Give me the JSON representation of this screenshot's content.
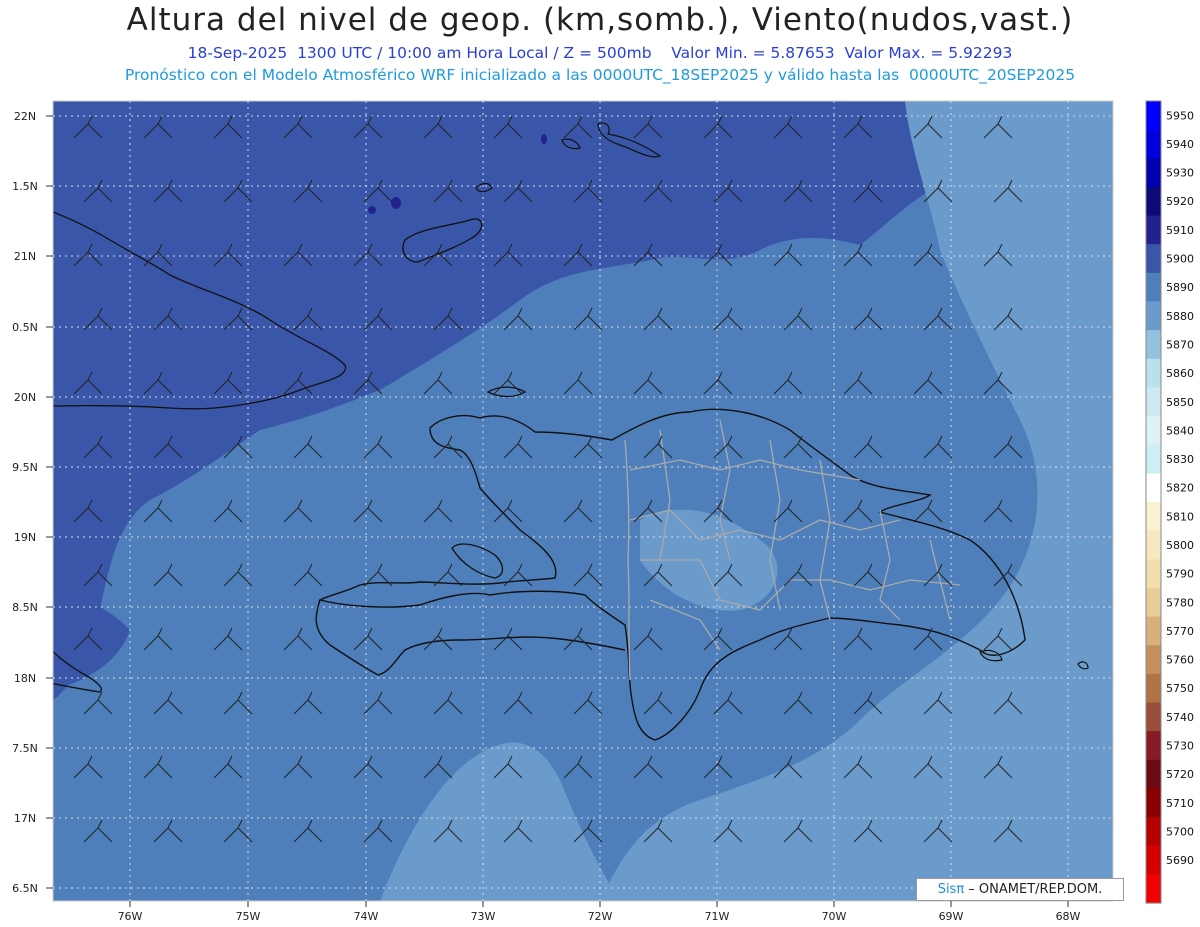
{
  "header": {
    "title": "Altura del nivel de geop. (km,somb.), Viento(nudos,vast.)",
    "subtitle1": "18-Sep-2025  1300 UTC / 10:00 am Hora Local / Z = 500mb    Valor Min. = 5.87653  Valor Max. = 5.92293",
    "subtitle2": "Pronóstico con el Modelo Atmosférico WRF inicializado a las 0000UTC_18SEP2025 y válido hasta las  0000UTC_20SEP2025"
  },
  "axes": {
    "y_ticks": [
      "22N",
      "1.5N",
      "21N",
      "0.5N",
      "20N",
      "9.5N",
      "19N",
      "8.5N",
      "18N",
      "7.5N",
      "17N",
      "6.5N"
    ],
    "x_ticks": [
      "76W",
      "75W",
      "74W",
      "73W",
      "72W",
      "71W",
      "70W",
      "69W",
      "68W"
    ]
  },
  "colorbar": {
    "labels": [
      "5950",
      "5940",
      "5930",
      "5920",
      "5910",
      "5900",
      "5890",
      "5880",
      "5870",
      "5860",
      "5850",
      "5840",
      "5830",
      "5820",
      "5810",
      "5800",
      "5790",
      "5780",
      "5770",
      "5760",
      "5750",
      "5740",
      "5730",
      "5720",
      "5710",
      "5700",
      "5690"
    ],
    "colors": [
      "#0000ff",
      "#0000dd",
      "#0000b0",
      "#0c0a78",
      "#22228e",
      "#3a56a8",
      "#4e7fbb",
      "#6a9bcb",
      "#94c2de",
      "#b9e0ec",
      "#cfe9f2",
      "#ddf1f6",
      "#cdeef5",
      "#ffffff",
      "#f9f1cf",
      "#f6e9c0",
      "#f2deac",
      "#e9cd98",
      "#d8b07e",
      "#c3905c",
      "#b07346",
      "#9b4e3a",
      "#851c26",
      "#6c0a14",
      "#8a0000",
      "#b40000",
      "#d40000",
      "#f00000"
    ]
  },
  "colors": {
    "deep_blue": "#3a56a8",
    "mid_blue": "#4e7fbb",
    "light_blue": "#6a9bcb",
    "coast": "#111111",
    "border": "#aaaaaa"
  },
  "credit": {
    "sis": "Sisπ",
    "text": " – ONAMET/REP.DOM."
  }
}
